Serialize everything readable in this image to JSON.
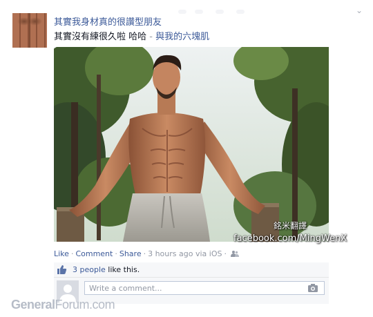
{
  "post": {
    "author": "其實我身材真的很讚型朋友",
    "text": "其實沒有練很久啦 哈哈",
    "separator": " - ",
    "tagged_with": "與我的六塊肌"
  },
  "photo": {
    "watermark_name": "銘米翻譯",
    "watermark_url": "facebook.com/MingWenX"
  },
  "actions": {
    "like": "Like",
    "comment": "Comment",
    "share": "Share",
    "dot": "·",
    "timestamp": "3 hours ago via iOS"
  },
  "likes": {
    "people": "3 people",
    "suffix": " like this."
  },
  "comment_box": {
    "placeholder": "Write a comment..."
  },
  "brand": {
    "bold": "General",
    "rest": "Forum.com"
  },
  "colors": {
    "link": "#3b5998",
    "muted": "#9197a3",
    "panel": "#f6f7f9"
  },
  "icons": [
    "chevron-down-icon",
    "like-thumb-icon",
    "friends-privacy-icon",
    "camera-icon"
  ]
}
